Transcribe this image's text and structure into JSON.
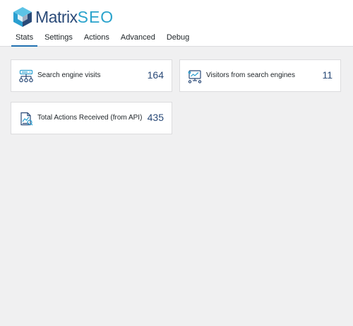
{
  "brand": {
    "word1": "Matrix",
    "word2": "SEO",
    "colors": {
      "dark": "#2a4a78",
      "accent": "#2aa3cc"
    }
  },
  "tabs": [
    {
      "label": "Stats",
      "active": true
    },
    {
      "label": "Settings",
      "active": false
    },
    {
      "label": "Actions",
      "active": false
    },
    {
      "label": "Advanced",
      "active": false
    },
    {
      "label": "Debug",
      "active": false
    }
  ],
  "stats": [
    {
      "icon": "network-sitemap-icon",
      "label": "Search engine visits",
      "value": "164"
    },
    {
      "icon": "monitor-analytics-icon",
      "label": "Visitors from search engines",
      "value": "11"
    },
    {
      "icon": "report-document-icon",
      "label": "Total Actions Received (from API)",
      "value": "435"
    }
  ]
}
